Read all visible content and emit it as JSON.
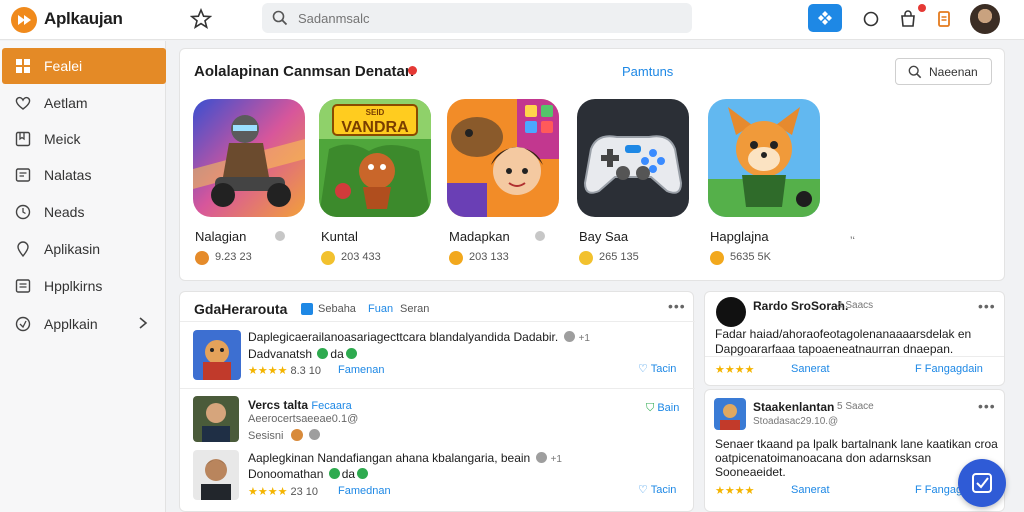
{
  "header": {
    "brand": "Aplkaujan",
    "search_placeholder": "Sadanmsalc"
  },
  "sidebar": {
    "items": [
      {
        "label": "Fealei",
        "icon": "grid-icon",
        "active": true
      },
      {
        "label": "Aetlam",
        "icon": "heart-icon"
      },
      {
        "label": "Meick",
        "icon": "bookmark-icon"
      },
      {
        "label": "Nalatas",
        "icon": "message-icon"
      },
      {
        "label": "Neads",
        "icon": "clock-icon"
      },
      {
        "label": "Aplikasin",
        "icon": "pin-icon"
      },
      {
        "label": "Hpplkirns",
        "icon": "list-icon"
      },
      {
        "label": "Applkain",
        "icon": "settings-icon"
      }
    ]
  },
  "featured": {
    "title": "Aolalapinan Canmsan Denatan",
    "tab": "Pamtuns",
    "button": "Naeenan",
    "apps": [
      {
        "name": "Nalagian",
        "stat": "9.23 23",
        "icon_art": "racer"
      },
      {
        "name": "Kuntal",
        "stat": "203 433",
        "icon_art": "vandra",
        "art_text": "VANDRA",
        "art_top": "SEID"
      },
      {
        "name": "Madapkan",
        "stat": "203 133",
        "icon_art": "girl"
      },
      {
        "name": "Bay Saa",
        "stat": "265 135",
        "icon_art": "controller"
      },
      {
        "name": "Hapglajna",
        "stat": "5635 5K",
        "icon_art": "fox"
      }
    ],
    "loading": "’‘"
  },
  "feed": {
    "title": "GdaHerarouta",
    "tag": "Sebaha",
    "tag2": "Fuan",
    "tag3": "Seran",
    "posts": [
      {
        "line1": "Daplegicaerailanoasariagecttcara blandalyandida Dadabir.",
        "line1_suffix": "+1",
        "line2": "Dadvanatsh",
        "badges": "da",
        "rating": "★★★★",
        "rating_num": "8.3 10",
        "link": "Famenan",
        "action": "Tacin"
      },
      {
        "name": "Vercs talta",
        "name_tag": "Fecaara",
        "sub": "Aeerocertsaeeae0.1@",
        "sub2": "Sesisni",
        "action": "Bain"
      },
      {
        "line1": "Aaplegkinan Nandafiangan ahana kbalangaria, beain",
        "line1_suffix": "+1",
        "line2": "Donoomathan",
        "badges": "da",
        "rating": "★★★★",
        "rating_num": "23 10",
        "link": "Famednan",
        "action": "Tacin"
      }
    ]
  },
  "cards": [
    {
      "title": "Rardo SroSorah.",
      "meta": "4 Saacs",
      "body1": "Fadar haiad/ahoraofeotagolenanaaaarsdelak en",
      "body2": "Dapgoararfaaa tapoaeneatnaurran dnaepan.",
      "rating": "★★★★",
      "link": "Sanerat",
      "link2": "Fangagdain"
    },
    {
      "title": "Staakenlantan",
      "meta": "5 Saace",
      "sub": "Stoadasac29.10.@",
      "body1": "Senaer tkaand pa lpalk bartalnank lane kaatikan croa",
      "body2": "oatpicenatoimanoacana don adarnsksan",
      "body3": "Sooneaeidet.",
      "rating": "★★★★",
      "link": "Sanerat",
      "link2": "Fangagan"
    }
  ],
  "colors": {
    "accent": "#e48a26",
    "primary": "#1e88e5",
    "fab": "#2f5bd6"
  }
}
